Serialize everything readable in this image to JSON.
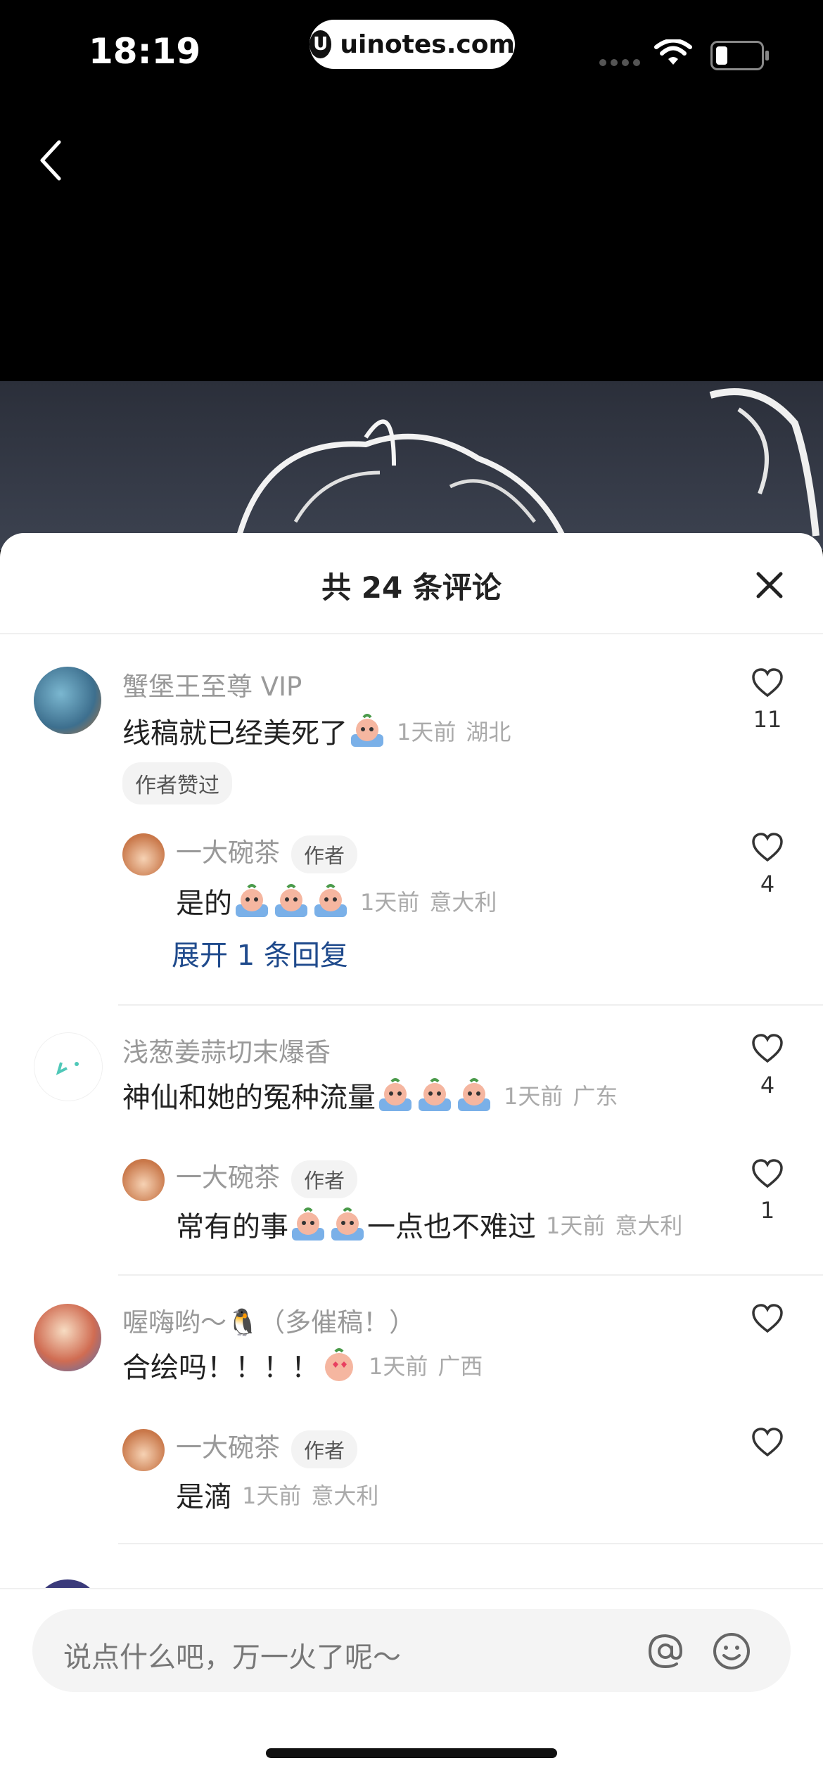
{
  "status_bar": {
    "time": "18:19",
    "url": "uinotes.com",
    "url_logo": "U"
  },
  "sheet": {
    "title": "共 24 条评论"
  },
  "comments": [
    {
      "user": "蟹堡王至尊 VIP",
      "text": "线稿就已经美死了",
      "time": "1天前",
      "location": "湖北",
      "tag": "作者赞过",
      "likes": "11",
      "reply": {
        "user": "一大碗茶",
        "author_tag": "作者",
        "text": "是的",
        "time": "1天前",
        "location": "意大利",
        "likes": "4"
      },
      "expand": "展开 1 条回复"
    },
    {
      "user": "浅葱姜蒜切末爆香",
      "text": "神仙和她的冤种流量",
      "time": "1天前",
      "location": "广东",
      "likes": "4",
      "reply": {
        "user": "一大碗茶",
        "author_tag": "作者",
        "text_a": "常有的事",
        "text_b": "一点也不难过",
        "time": "1天前",
        "location": "意大利",
        "likes": "1"
      }
    },
    {
      "user": "喔嗨哟～🐧（多催稿！）",
      "text": "合绘吗！！！！",
      "time": "1天前",
      "location": "广西",
      "reply": {
        "user": "一大碗茶",
        "author_tag": "作者",
        "text": "是滴",
        "time": "1天前",
        "location": "意大利"
      }
    }
  ],
  "input": {
    "placeholder": "说点什么吧，万一火了呢～"
  },
  "icons": {
    "back": "chevron-left-icon",
    "close": "close-icon",
    "like": "heart-outline-icon",
    "mention": "at-icon",
    "emoji": "smile-icon"
  }
}
